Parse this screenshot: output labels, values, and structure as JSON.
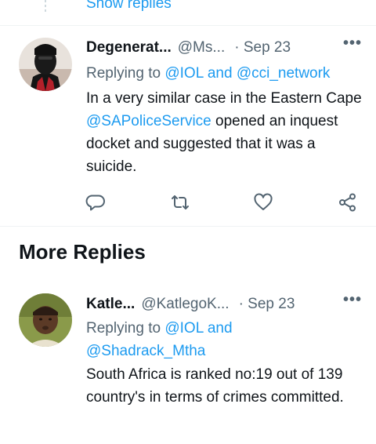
{
  "top": {
    "show_replies": "Show replies"
  },
  "tweets": [
    {
      "name": "Degenerat...",
      "handle": "@Ms...",
      "date": "· Sep 23",
      "more": "•••",
      "replying_prefix": "Replying to ",
      "replying_link1": "@IOL",
      "replying_and": " and ",
      "replying_link2": "@cci_network",
      "body_1": "In a very similar case in the Eastern Cape ",
      "body_mention": "@SAPoliceService",
      "body_2": " opened an inquest docket and suggested that it was a suicide.",
      "actions": [
        "reply-icon",
        "retweet-icon",
        "like-icon",
        "share-icon"
      ]
    },
    {
      "name": "Katle...",
      "handle": "@KatlegoK...",
      "date": "· Sep 23",
      "more": "•••",
      "replying_prefix": "Replying to ",
      "replying_link1": "@IOL",
      "replying_and": " and",
      "replying_link2": "@Shadrack_Mtha",
      "body": "South Africa is ranked no:19 out of 139 country's in terms of crimes committed."
    }
  ],
  "section": {
    "title": "More Replies"
  },
  "colors": {
    "accent": "#1d9bf0",
    "muted": "#536471",
    "text": "#0f1419",
    "divider": "#eff3f4"
  }
}
